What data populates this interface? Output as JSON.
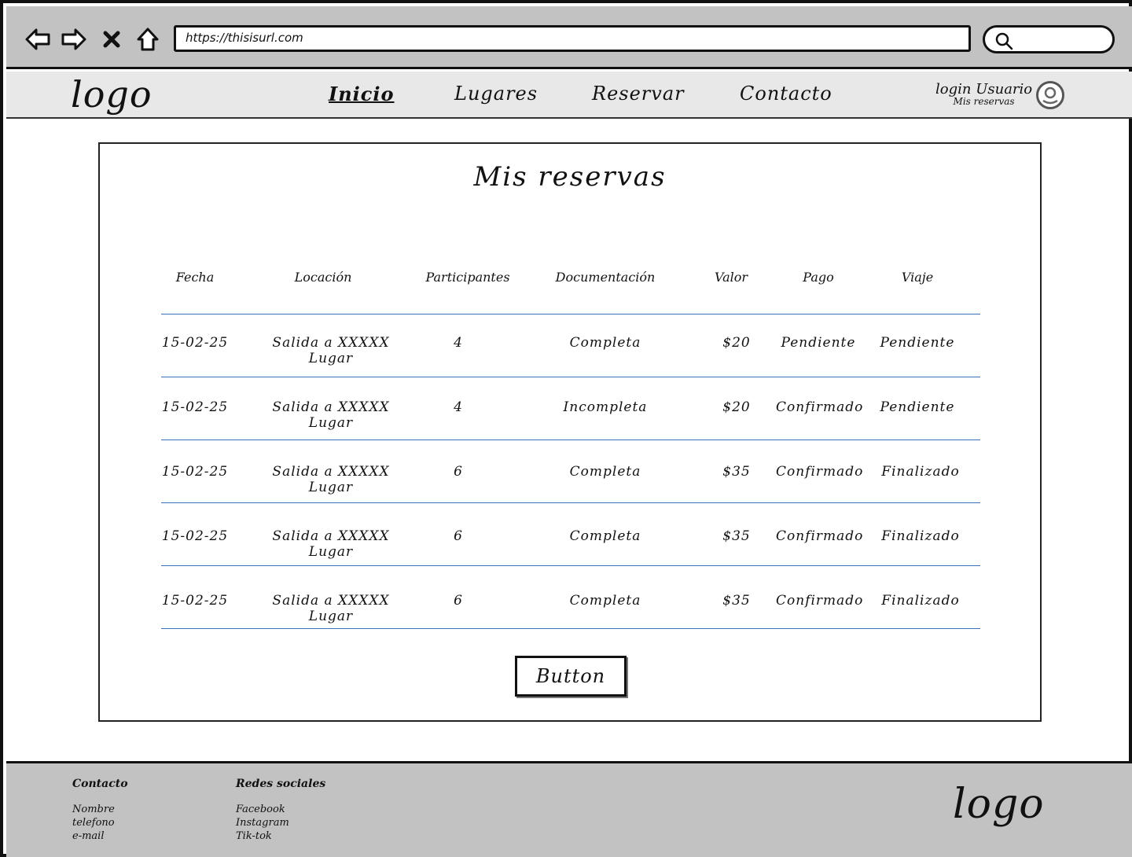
{
  "browser": {
    "url": "https://thisisurl.com",
    "icons": [
      "back-arrow-icon",
      "forward-arrow-icon",
      "close-icon",
      "home-icon",
      "search-icon"
    ]
  },
  "header": {
    "logo": "logo",
    "menu": [
      {
        "label": "Inicio",
        "active": true
      },
      {
        "label": "Lugares",
        "active": false
      },
      {
        "label": "Reservar",
        "active": false
      },
      {
        "label": "Contacto",
        "active": false
      }
    ],
    "user": {
      "login_label": "login Usuario",
      "sub_label": "Mis reservas"
    }
  },
  "main": {
    "title": "Mis reservas",
    "table": {
      "columns": [
        "Fecha",
        "Locación",
        "Participantes",
        "Documentación",
        "Valor",
        "Pago",
        "Viaje"
      ],
      "rows": [
        [
          "15-02-25",
          "Salida a XXXXX Lugar",
          "4",
          "Completa",
          "$20",
          "Pendiente",
          "Pendiente"
        ],
        [
          "15-02-25",
          "Salida a XXXXX Lugar",
          "4",
          "Incompleta",
          "$20",
          "Confirmado",
          "Pendiente"
        ],
        [
          "15-02-25",
          "Salida a XXXXX Lugar",
          "6",
          "Completa",
          "$35",
          "Confirmado",
          "Finalizado"
        ],
        [
          "15-02-25",
          "Salida a XXXXX Lugar",
          "6",
          "Completa",
          "$35",
          "Confirmado",
          "Finalizado"
        ],
        [
          "15-02-25",
          "Salida a XXXXX Lugar",
          "6",
          "Completa",
          "$35",
          "Confirmado",
          "Finalizado"
        ]
      ]
    },
    "button_label": "Button"
  },
  "footer": {
    "contact": {
      "heading": "Contacto",
      "items": [
        "Nombre",
        "telefono",
        "e-mail"
      ]
    },
    "social": {
      "heading": "Redes sociales",
      "items": [
        "Facebook",
        "Instagram",
        "Tik-tok"
      ]
    },
    "logo": "logo"
  }
}
